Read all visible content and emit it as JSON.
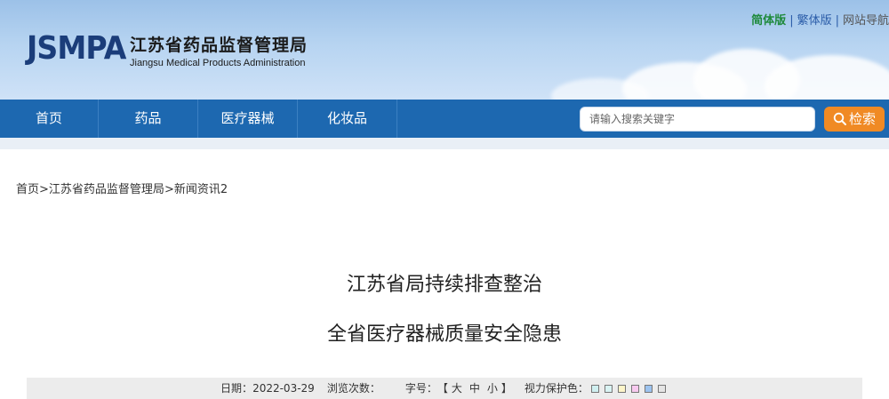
{
  "header": {
    "logo_mark": "JSMPA",
    "title_cn": "江苏省药品监督管理局",
    "title_en": "Jiangsu Medical Products Administration",
    "lang_simplified": "简体版",
    "lang_traditional": "繁体版",
    "site_nav": "网站导航"
  },
  "nav": {
    "items": [
      {
        "label": "首页"
      },
      {
        "label": "药品"
      },
      {
        "label": "医疗器械"
      },
      {
        "label": "化妆品"
      }
    ],
    "search_placeholder": "请输入搜索关键字",
    "search_button": "检索"
  },
  "breadcrumb": {
    "home": "首页",
    "sep": ">",
    "bureau": "江苏省药品监督管理局",
    "section": "新闻资讯2"
  },
  "article": {
    "title_line1": "江苏省局持续排查整治",
    "title_line2": "全省医疗器械质量安全隐患"
  },
  "info": {
    "date_label": "日期：",
    "date_value": "2022-03-29",
    "views_label": "浏览次数：",
    "font_label": "字号：",
    "font_open": "【",
    "font_large": "大",
    "font_medium": "中",
    "font_small": "小",
    "font_close": "】",
    "eye_label": "视力保护色：",
    "swatches": [
      "#cfeff0",
      "#d9f3f3",
      "#fdf5c9",
      "#f7c9ef",
      "#9cc3ef",
      "#e5e5e5"
    ]
  },
  "colors": {
    "nav_bg": "#1d68b0",
    "search_button_bg": "#f08a24",
    "logo_color": "#1b3d7a"
  }
}
